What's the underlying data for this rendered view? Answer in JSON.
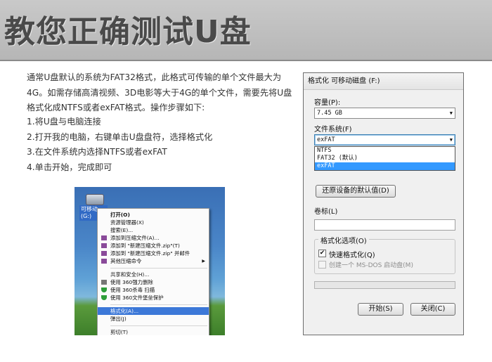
{
  "page": {
    "title": "教您正确测试U盘",
    "intro": "通常U盘默认的系统为FAT32格式，此格式可传输的单个文件最大为4G。如需存储高清视频、3D电影等大于4G的单个文件，需要先将U盘格式化成NTFS或者exFAT格式。操作步骤如下:",
    "steps": [
      "1.将U盘与电脑连接",
      "2.打开我的电脑，右键单击U盘盘符，选择格式化",
      "3.在文件系统内选择NTFS或者exFAT",
      "4.单击开始，完成即可"
    ]
  },
  "explorer": {
    "drive_label": "可移动 (G:)",
    "context_menu": [
      {
        "label": "打开(O)",
        "bold": true
      },
      {
        "label": "资源管理器(X)"
      },
      {
        "label": "搜索(E)..."
      },
      {
        "label": "添加到压缩文件(A)..."
      },
      {
        "label": "添加到 \"新建压缩文件.zip\"(T)"
      },
      {
        "label": "添加到 \"新建压缩文件.zip\" 并邮件"
      },
      {
        "label": "其他压缩命令",
        "submenu": true
      },
      {
        "label": "共享和安全(H)..."
      },
      {
        "label": "使用 360强力删除"
      },
      {
        "label": "使用 360杀毒 扫描"
      },
      {
        "label": "使用 360文件堡垒保护"
      },
      {
        "label": "格式化(A)...",
        "highlighted": true
      },
      {
        "label": "弹出(J)"
      },
      {
        "label": "剪切(T)"
      }
    ]
  },
  "dialog": {
    "title": "格式化 可移动磁盘 (F:)",
    "capacity_label": "容量(P):",
    "capacity_value": "7.45 GB",
    "filesystem_label": "文件系统(F)",
    "filesystem_value": "exFAT",
    "filesystem_options": [
      "NTFS",
      "FAT32 (默认)",
      "exFAT"
    ],
    "restore_button": "还原设备的默认值(D)",
    "volume_label": "卷标(L)",
    "volume_value": "",
    "options_group": "格式化选项(O)",
    "quick_format": "快速格式化(Q)",
    "quick_format_checked": true,
    "msdos_disk": "创建一个 MS-DOS 启动盘(M)",
    "msdos_checked": false,
    "progress": 0,
    "start_button": "开始(S)",
    "close_button": "关闭(C)"
  },
  "colors": {
    "banner": "#c0c0c0",
    "title_text": "#4a4a4a",
    "menu_highlight": "#3c78d8",
    "dropdown_selection": "#3399ff"
  }
}
